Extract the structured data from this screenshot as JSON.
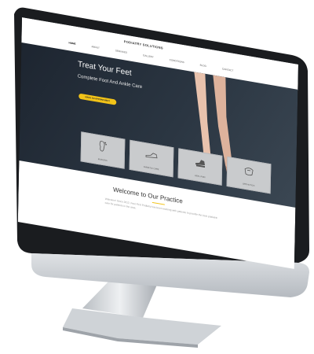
{
  "site": {
    "logo": "PODIATRY SOLUTIONS",
    "nav": [
      "HOME",
      "ABOUT",
      "SERVICES",
      "GALLERY",
      "CONDITIONS",
      "BLOG",
      "CONTACT"
    ],
    "hero": {
      "title": "Treat Your Feet",
      "subtitle": "Complete Foot And Ankle Care",
      "cta": "MAKE AN APPOINTMENT"
    },
    "tiles": [
      {
        "label": "BUNIONS",
        "icon": "foot-icon"
      },
      {
        "label": "DIABETIC CARE",
        "icon": "shoe-icon"
      },
      {
        "label": "HEEL PAIN",
        "icon": "heel-icon"
      },
      {
        "label": "ORTHOTICS",
        "icon": "orthotic-icon"
      }
    ],
    "welcome": {
      "title": "Welcome to Our Practice",
      "text": "Welcome! Since 2012, Feet First Podiatry has been working with patients to provide the best podiatric care for patients in the area."
    }
  },
  "colors": {
    "hero_bg": "#1d2530",
    "accent": "#f2c318",
    "tile_bg": "#c9cbcd"
  }
}
